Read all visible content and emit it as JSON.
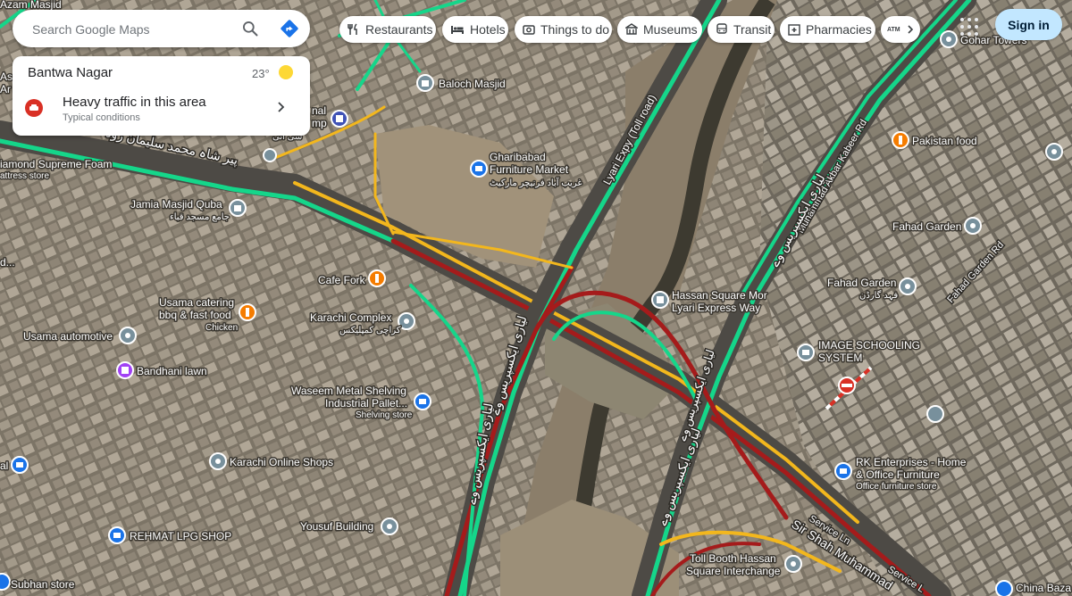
{
  "search": {
    "placeholder": "Search Google Maps"
  },
  "info_card": {
    "area": "Bantwa Nagar",
    "temperature": "23°",
    "traffic_title": "Heavy traffic in this area",
    "traffic_subtitle": "Typical conditions"
  },
  "chips": [
    {
      "label": "Restaurants",
      "icon": "restaurant-icon"
    },
    {
      "label": "Hotels",
      "icon": "hotel-icon"
    },
    {
      "label": "Things to do",
      "icon": "camera-icon"
    },
    {
      "label": "Museums",
      "icon": "museum-icon"
    },
    {
      "label": "Transit",
      "icon": "transit-icon"
    },
    {
      "label": "Pharmacies",
      "icon": "pharmacy-icon"
    }
  ],
  "header": {
    "signin": "Sign in",
    "chip_overflow": "ATM"
  },
  "places": {
    "azam_masjid": "Azam Masjid",
    "baloch_masjid": "Baloch Masjid",
    "gharibabad": "Gharibabad",
    "gharibabad_2": "Furniture Market",
    "gharibabad_urdu": "غریب آباد فرنیچر مارکیٹ",
    "diamond_foam": "iamond Supreme Foam",
    "diamond_sub": "attress store",
    "jamia_masjid": "Jamia Masjid Quba",
    "jamia_urdu": "جامع مسجد قباء",
    "d_label": "d...",
    "cafe_fork": "Cafe Fork",
    "usama_catering": "Usama catering",
    "usama_catering_2": "bbq & fast food",
    "usama_catering_sub": "Chicken",
    "karachi_complex": "Karachi Complex",
    "karachi_complex_urdu": "کراچی کمپلیکس",
    "usama_automotive": "Usama automotive",
    "bandhani_lawn": "Bandhani lawn",
    "waseem_metal": "Waseem Metal Shelving",
    "waseem_metal_2": "Industrial Pallet...",
    "waseem_metal_sub": "Shelving store",
    "karachi_online": "Karachi Online Shops",
    "yousuf_building": "Yousuf Building",
    "rehmat_lpg": "REHMAT LPG SHOP",
    "subhan_store": "Subhan store",
    "gohar_towers": "Gohar Towers",
    "pakistan_food": "Pakistan food",
    "fahad_garden": "Fahad Garden",
    "fahad_garden_2": "Fahad Garden",
    "fahad_garden_urdu": "فہد گارڈن",
    "hassan_square": "Hassan Square Mor",
    "hassan_square_2": "Lyari Express Way",
    "image_school": "IMAGE SCHOOLING",
    "image_school_2": "SYSTEM",
    "rk_enterprises": "RK Enterprises - Home",
    "rk_enterprises_2": "& Office Furniture",
    "rk_enterprises_sub": "Office furniture store",
    "toll_booth": "Toll Booth Hassan",
    "toll_booth_2": "Square Interchange",
    "china_bazar": "China Baza",
    "nal_label": "nal",
    "mp_label": "mp",
    "as_label": "As",
    "al_label": "al",
    "sui_label": "سی آئی",
    "ar_label": "Ar"
  },
  "roads": {
    "lyari_toll": "Lyari Expy (Toll road)",
    "akbar_kabeer": "Muhammad Akbar Kabeer Rd",
    "fahad_garden_rd": "Fahad Garden Rd",
    "service_ln": "Service Ln",
    "service_ln_2": "Service L",
    "sir_shah": "Sir Shah Muhammad",
    "lyari_urdu_1": "لیاری ایکسپریس وے",
    "lyari_urdu_2": "لیاری ایکسپریس وے",
    "lyari_urdu_3": "لیاری ایکسپریس وے",
    "lyari_urdu_4": "لیاری ایکسپریس وے",
    "lyari_urdu_5": "لیاری ایکسپریس وے",
    "sulaiman_road": "پیر شاہ محمد سلیمان روڈ"
  },
  "colors": {
    "traffic_green": "#15d68a",
    "traffic_red": "#a51b1b",
    "traffic_yellow": "#f3b71d",
    "accent_blue": "#1a73e8",
    "signin_bg": "#c2e7ff"
  }
}
